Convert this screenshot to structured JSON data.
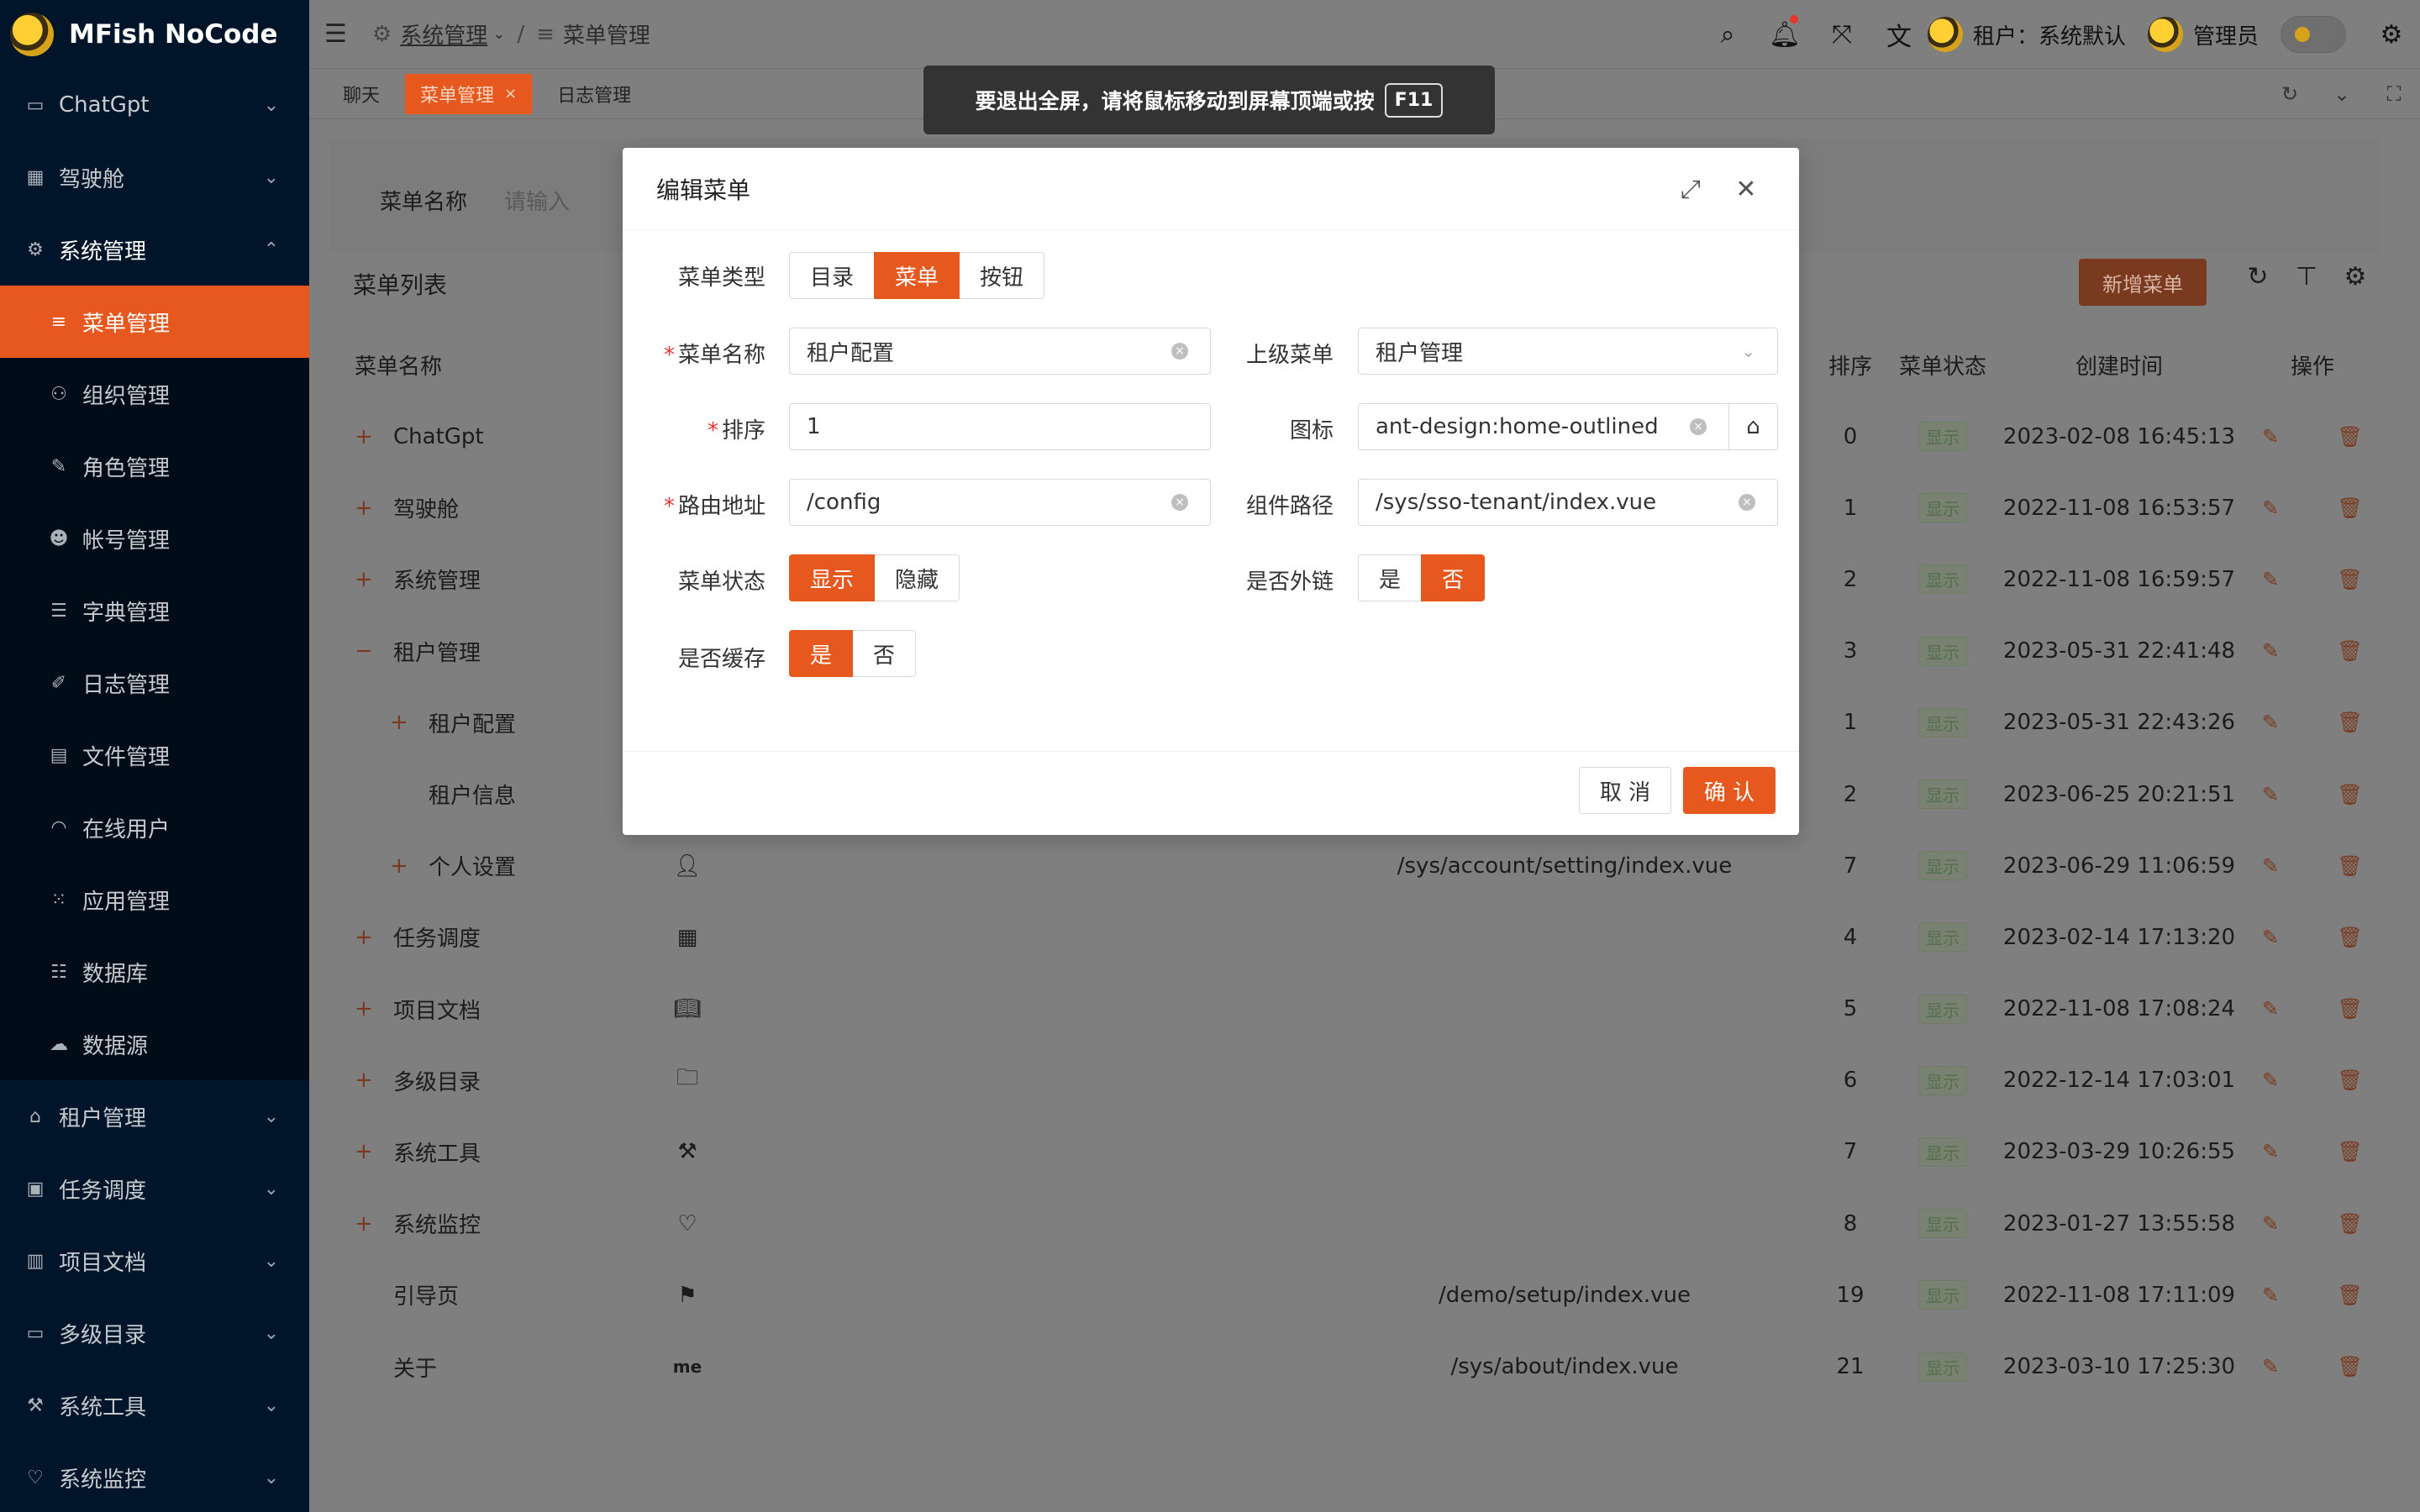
{
  "app": {
    "name": "MFish NoCode"
  },
  "sidebar": {
    "items": [
      {
        "label": "ChatGpt",
        "icon": "chat-icon"
      },
      {
        "label": "驾驶舱",
        "icon": "dashboard-icon"
      },
      {
        "label": "系统管理",
        "icon": "gear-icon"
      },
      {
        "label": "租户管理",
        "icon": "tenant-icon"
      },
      {
        "label": "任务调度",
        "icon": "schedule-icon"
      },
      {
        "label": "项目文档",
        "icon": "book-icon"
      },
      {
        "label": "多级目录",
        "icon": "folder-icon"
      },
      {
        "label": "系统工具",
        "icon": "tool-icon"
      },
      {
        "label": "系统监控",
        "icon": "monitor-icon"
      }
    ],
    "sub_items": [
      {
        "label": "菜单管理",
        "active": true
      },
      {
        "label": "组织管理"
      },
      {
        "label": "角色管理"
      },
      {
        "label": "帐号管理"
      },
      {
        "label": "字典管理"
      },
      {
        "label": "日志管理"
      },
      {
        "label": "文件管理"
      },
      {
        "label": "在线用户"
      },
      {
        "label": "应用管理"
      },
      {
        "label": "数据库"
      },
      {
        "label": "数据源"
      }
    ]
  },
  "header": {
    "breadcrumb": [
      "系统管理",
      "菜单管理"
    ],
    "tenant_label": "租户：系统默认",
    "user_label": "管理员"
  },
  "tabs": [
    {
      "label": "聊天"
    },
    {
      "label": "菜单管理",
      "active": true
    },
    {
      "label": "日志管理"
    }
  ],
  "toast": {
    "text": "要退出全屏，请将鼠标移动到屏幕顶端或按",
    "key": "F11"
  },
  "search": {
    "label": "菜单名称",
    "placeholder": "请输入"
  },
  "list": {
    "title": "菜单列表",
    "add_button": "新增菜单",
    "columns": {
      "name": "菜单名称",
      "sort": "排序",
      "status": "菜单状态",
      "created": "创建时间",
      "ops": "操作"
    },
    "rows": [
      {
        "name": "ChatGpt",
        "sort": "0",
        "status": "显示",
        "time": "2023-02-08 16:45:13",
        "expand": "+"
      },
      {
        "name": "驾驶舱",
        "sort": "1",
        "status": "显示",
        "time": "2022-11-08 16:53:57",
        "expand": "+"
      },
      {
        "name": "系统管理",
        "sort": "2",
        "status": "显示",
        "time": "2022-11-08 16:59:57",
        "expand": "+"
      },
      {
        "name": "租户管理",
        "sort": "3",
        "status": "显示",
        "time": "2023-05-31 22:41:48",
        "expand": "−"
      },
      {
        "name": "租户配置",
        "sort": "1",
        "status": "显示",
        "time": "2023-05-31 22:43:26",
        "expand": "+",
        "indent": 1
      },
      {
        "name": "租户信息",
        "sort": "2",
        "status": "显示",
        "time": "2023-06-25 20:21:51",
        "expand": "",
        "indent": 1
      },
      {
        "name": "个人设置",
        "sort": "7",
        "status": "显示",
        "time": "2023-06-29 11:06:59",
        "expand": "+",
        "indent": 1,
        "icon": "user-icon",
        "component": "/sys/account/setting/index.vue"
      },
      {
        "name": "任务调度",
        "sort": "4",
        "status": "显示",
        "time": "2023-02-14 17:13:20",
        "expand": "+",
        "icon": "calendar-icon"
      },
      {
        "name": "项目文档",
        "sort": "5",
        "status": "显示",
        "time": "2022-11-08 17:08:24",
        "expand": "+",
        "icon": "book-icon"
      },
      {
        "name": "多级目录",
        "sort": "6",
        "status": "显示",
        "time": "2022-12-14 17:03:01",
        "expand": "+",
        "icon": "folder-icon"
      },
      {
        "name": "系统工具",
        "sort": "7",
        "status": "显示",
        "time": "2023-03-29 10:26:55",
        "expand": "+",
        "icon": "tool-icon"
      },
      {
        "name": "系统监控",
        "sort": "8",
        "status": "显示",
        "time": "2023-01-27 13:55:58",
        "expand": "+",
        "icon": "heart-icon"
      },
      {
        "name": "引导页",
        "sort": "19",
        "status": "显示",
        "time": "2022-11-08 17:11:09",
        "expand": "",
        "icon": "paint-icon",
        "component": "/demo/setup/index.vue"
      },
      {
        "name": "关于",
        "sort": "21",
        "status": "显示",
        "time": "2023-03-10 17:25:30",
        "expand": "",
        "icon_text": "me",
        "component": "/sys/about/index.vue"
      }
    ]
  },
  "modal": {
    "title": "编辑菜单",
    "type_label": "菜单类型",
    "type_options": [
      "目录",
      "菜单",
      "按钮"
    ],
    "type_selected": "菜单",
    "name_label": "菜单名称",
    "name_value": "租户配置",
    "parent_label": "上级菜单",
    "parent_value": "租户管理",
    "sort_label": "排序",
    "sort_value": "1",
    "icon_label": "图标",
    "icon_value": "ant-design:home-outlined",
    "route_label": "路由地址",
    "route_value": "/config",
    "component_label": "组件路径",
    "component_value": "/sys/sso-tenant/index.vue",
    "status_label": "菜单状态",
    "status_options": [
      "显示",
      "隐藏"
    ],
    "status_selected": "显示",
    "external_label": "是否外链",
    "external_options": [
      "是",
      "否"
    ],
    "external_selected": "否",
    "cache_label": "是否缓存",
    "cache_options": [
      "是",
      "否"
    ],
    "cache_selected": "是",
    "cancel": "取 消",
    "ok": "确 认"
  },
  "colors": {
    "primary": "#e6581d",
    "sidebar": "#001529"
  }
}
